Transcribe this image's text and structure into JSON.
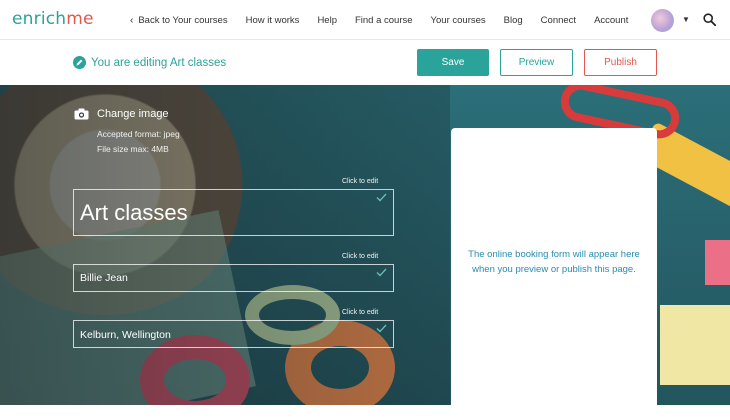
{
  "logo": {
    "part1": "enrich",
    "part2": "me"
  },
  "nav": {
    "back_label": "Back to Your courses",
    "items": [
      "How it works",
      "Help",
      "Find a course",
      "Your courses",
      "Blog",
      "Connect",
      "Account"
    ]
  },
  "editbar": {
    "status": "You are editing Art classes",
    "save_label": "Save",
    "preview_label": "Preview",
    "publish_label": "Publish"
  },
  "hero": {
    "change_image_label": "Change image",
    "accepted_format": "Accepted format: jpeg",
    "file_size": "File size max: 4MB",
    "click_hint": "Click to edit",
    "title": "Art classes",
    "provider": "Billie Jean",
    "location": "Kelburn, Wellington"
  },
  "booking": {
    "message": "The online booking form will appear here when you preview or publish this page."
  },
  "colors": {
    "brand_teal": "#2aa39a",
    "brand_red": "#e4574a",
    "booking_text": "#2a8bb0"
  }
}
